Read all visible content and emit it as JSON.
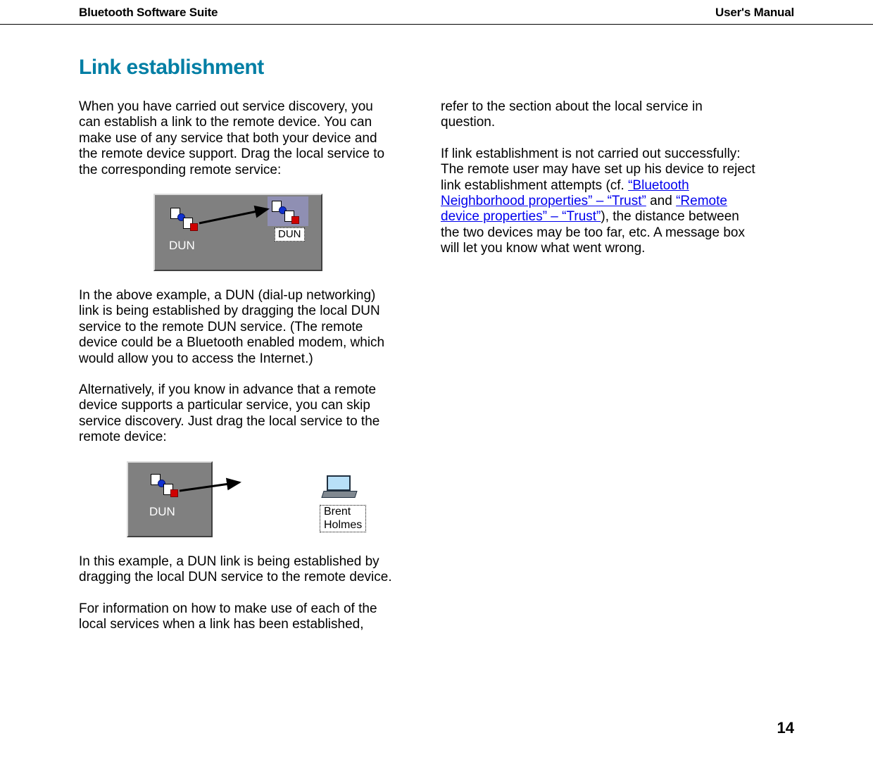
{
  "header": {
    "left": "Bluetooth Software Suite",
    "right": "User's Manual"
  },
  "heading": "Link establishment",
  "col1": {
    "p1": "When you have carried out service discovery, you can establish a link to the remote device. You can make use of any service that both your device and the remote device support. Drag the local service to the corresponding remote service:",
    "fig1": {
      "left_label": "DUN",
      "right_label": "DUN"
    },
    "p2": "In the above example, a DUN (dial-up networking) link is being established by dragging the local DUN service to the remote DUN service. (The remote device could be a Bluetooth enabled modem, which would allow you to access the Internet.)",
    "p3": "Alternatively, if you know in advance that a remote device supports a particular service, you can skip service discovery. Just drag the local service to the remote device:",
    "fig2": {
      "left_label": "DUN",
      "right_label": "Brent Holmes"
    },
    "p4": "In this example, a DUN link is being established by dragging the local DUN service to the remote device.",
    "p5": "For information on how to make use of each of the local services when a link has been established,"
  },
  "col2": {
    "p1": "refer to the section about the local service in question.",
    "p2a": "If link establishment is not carried out successfully: The remote user may have set up his device to reject link establishment attempts (cf. ",
    "link1": "“Bluetooth Neighborhood properties” – “Trust”",
    "mid": " and ",
    "link2": "“Remote device properties” – “Trust”",
    "p2b": "), the distance between the two devices may be too far, etc. A message box will let you know what went wrong."
  },
  "page_number": "14"
}
